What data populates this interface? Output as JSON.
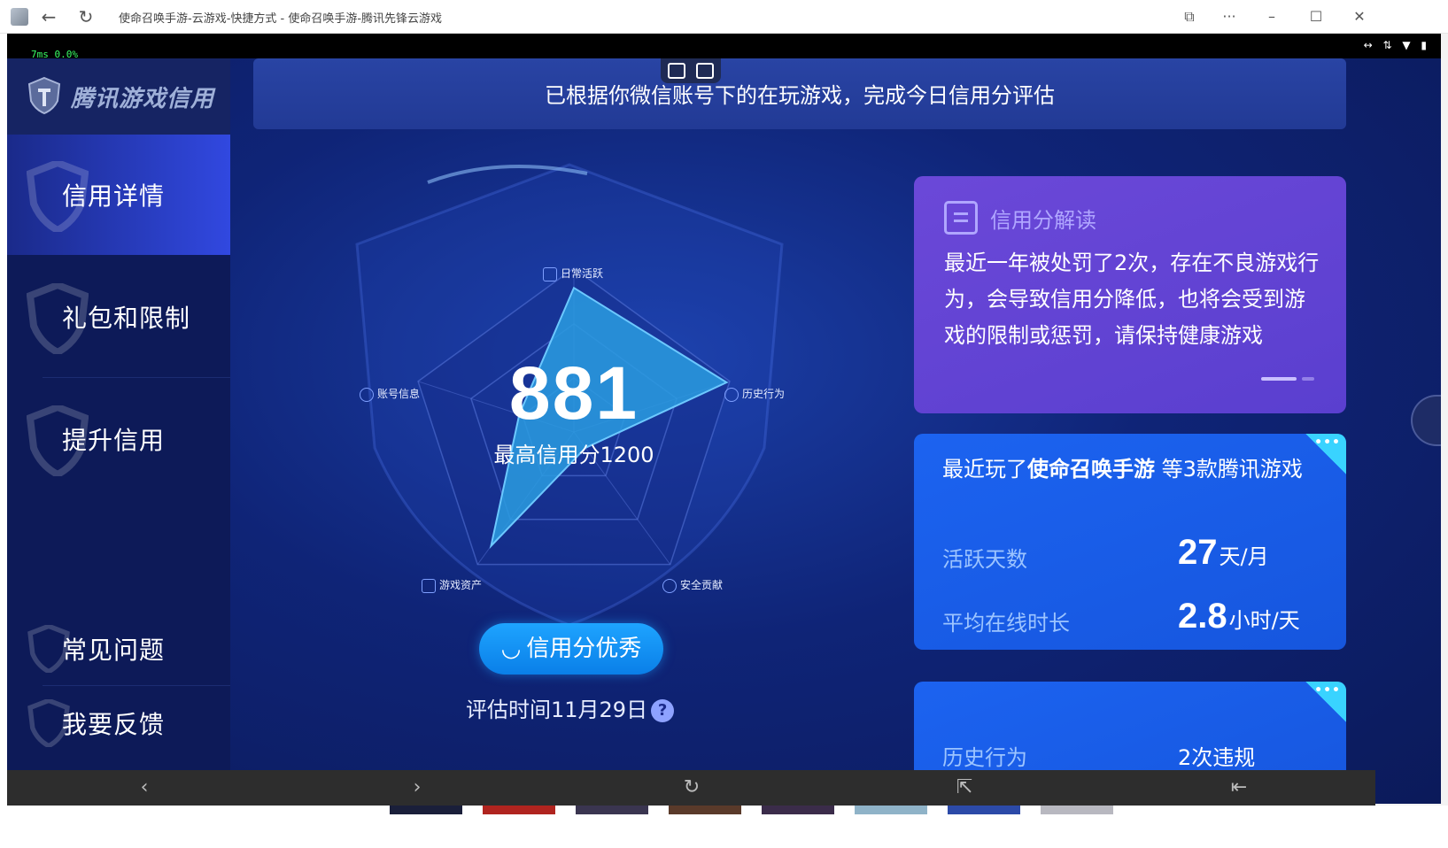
{
  "window": {
    "title": "使命召唤手游-云游戏-快捷方式 - 使命召唤手游-腾讯先锋云游戏"
  },
  "status": {
    "perf": "7ms 0.0%"
  },
  "logo": {
    "text": "腾讯游戏信用"
  },
  "sidebar": {
    "items": [
      {
        "label": "信用详情"
      },
      {
        "label": "礼包和限制"
      },
      {
        "label": "提升信用"
      },
      {
        "label": "常见问题"
      },
      {
        "label": "我要反馈"
      }
    ]
  },
  "banner": {
    "text": "已根据你微信账号下的在玩游戏，完成今日信用分评估"
  },
  "radar": {
    "score": "881",
    "max_label": "最高信用分1200",
    "axes": [
      "日常活跃",
      "历史行为",
      "安全贡献",
      "游戏资产",
      "账号信息"
    ],
    "values": [
      0.88,
      0.98,
      0.12,
      0.86,
      0.35
    ],
    "rating_badge": "信用分优秀",
    "eval_time": "评估时间11月29日",
    "help_icon": "question-icon"
  },
  "interpretation": {
    "title": "信用分解读",
    "body": "最近一年被处罚了2次，存在不良游戏行为，会导致信用分降低，也将会受到游戏的限制或惩罚，请保持健康游戏"
  },
  "recent": {
    "prefix": "最近玩了",
    "game": "使命召唤手游",
    "suffix": "等3款腾讯游戏",
    "stats": [
      {
        "label": "活跃天数",
        "value": "27",
        "unit": "天/月"
      },
      {
        "label": "平均在线时长",
        "value": "2.8",
        "unit": "小时/天"
      }
    ]
  },
  "history": {
    "label": "历史行为",
    "value": "2次违规"
  },
  "colors": {
    "accent": "#1ea4ff",
    "card_purple": "#6b48d8",
    "card_blue": "#1c63f0",
    "radar_fill": "#2a9ce0"
  }
}
